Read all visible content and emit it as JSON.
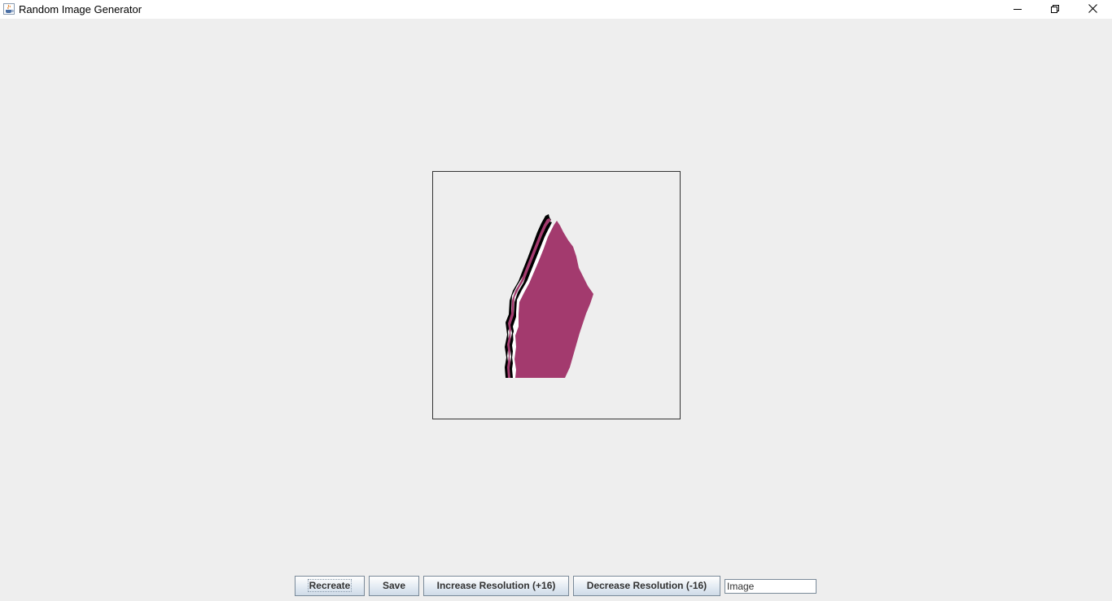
{
  "window": {
    "title": "Random Image Generator",
    "icons": {
      "app": "java-coffee-cup-icon",
      "minimize": "minimize-icon",
      "maximize": "restore-icon",
      "close": "close-icon"
    }
  },
  "canvas": {
    "shape_color": "#a33a6e",
    "border_color": "#333333"
  },
  "toolbar": {
    "recreate_label": "Recreate",
    "save_label": "Save",
    "increase_label": "Increase Resolution (+16)",
    "decrease_label": "Decrease Resolution (-16)",
    "name_value": "Image"
  },
  "colors": {
    "background": "#eeeeee",
    "titlebar": "#ffffff"
  }
}
